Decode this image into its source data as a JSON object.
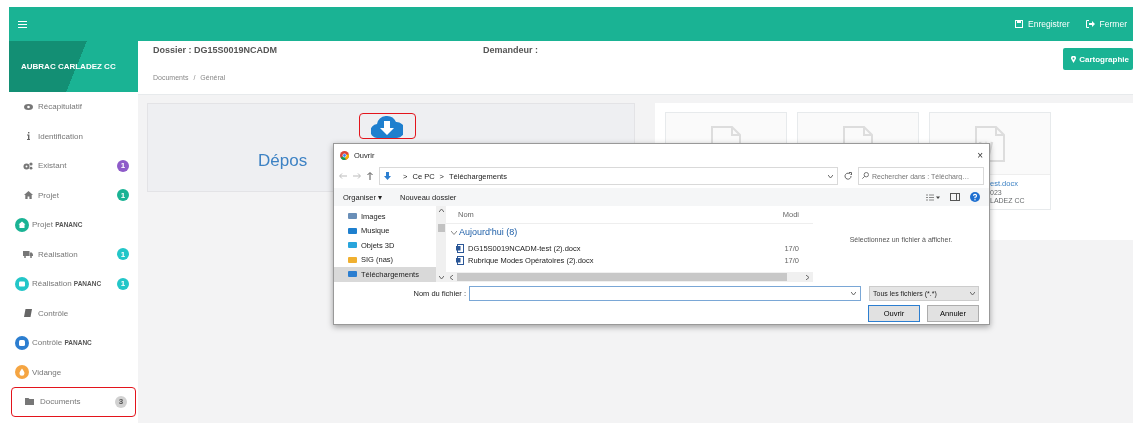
{
  "topbar": {
    "actions": [
      {
        "kind": "save",
        "label": "Enregistrer"
      },
      {
        "kind": "exit",
        "label": "Fermer"
      }
    ]
  },
  "sidebar": {
    "title": "AUBRAC CARLADEZ CC",
    "items": [
      {
        "kind": "plain",
        "label": "Récapitulatif",
        "highlighted": false
      },
      {
        "kind": "plain",
        "label": "Identification",
        "highlighted": false
      },
      {
        "kind": "plain",
        "label": "Existant",
        "badge": {
          "label": "1",
          "color": "#8e5bc9"
        },
        "highlighted": false
      },
      {
        "kind": "plain",
        "label": "Projet",
        "badge": {
          "label": "1",
          "color": "#1ab394"
        },
        "highlighted": false
      },
      {
        "kind": "round",
        "label": "Projet **PANANC**",
        "color": "#1ab394",
        "highlighted": false
      },
      {
        "kind": "plain",
        "label": "Réalisation",
        "badge": {
          "label": "1",
          "color": "#23c6c8"
        },
        "highlighted": false
      },
      {
        "kind": "round",
        "label": "Réalisation **PANANC**",
        "color": "#23c6c8",
        "badge": {
          "label": "1",
          "color": "#23c6c8"
        },
        "highlighted": false
      },
      {
        "kind": "plain",
        "label": "Contrôle",
        "highlighted": false
      },
      {
        "kind": "round",
        "label": "Contrôle **PANANC**",
        "color": "#2c7ed0",
        "highlighted": false
      },
      {
        "kind": "round",
        "label": "Vidange",
        "color": "#f5a542",
        "highlighted": false
      },
      {
        "kind": "plain",
        "label": "Documents",
        "badge": {
          "label": "3",
          "color": "#d1d1d1"
        },
        "highlighted": true
      }
    ]
  },
  "header": {
    "dossier": "Dossier : DG15S0019NCADM",
    "demandeur": "Demandeur :",
    "breadcrumb": {
      "items": [
        "Documents",
        "Général"
      ],
      "separator": "/"
    },
    "button": "Cartographie"
  },
  "upload": {
    "text": "Dépos",
    "highlighted": true
  },
  "files": [
    {
      "kind": "txt"
    },
    {
      "kind": "txt"
    },
    {
      "kind": "word",
      "name": "est.docx",
      "date": "023",
      "owner": "LADEZ CC"
    }
  ],
  "dialog": {
    "title": "Ouvrir",
    "close": "×",
    "path": [
      "Ce PC",
      "Téléchargements"
    ],
    "path_separator": ">",
    "search": {
      "placeholder": "Rechercher dans : Télécharg…"
    },
    "toolbar": [
      "Organiser ▾",
      "Nouveau dossier"
    ],
    "nav": [
      {
        "label": "Images",
        "selected": false
      },
      {
        "label": "Musique",
        "selected": false
      },
      {
        "label": "Objets 3D",
        "selected": false
      },
      {
        "label": "SIG (nas)",
        "selected": false
      },
      {
        "label": "Téléchargements",
        "selected": true
      }
    ],
    "columns": [
      "Nom",
      "Modi"
    ],
    "group": "Aujourd'hui (8)",
    "files": [
      {
        "name": "DG15S0019NCADM-test (2).docx",
        "date": "17/0"
      },
      {
        "name": "Rubrique Modes Opératoires (2).docx",
        "date": "17/0"
      }
    ],
    "preview": "Sélectionnez un fichier à afficher.",
    "filename_label": "Nom du fichier :",
    "filter": "Tous les fichiers (*.*)",
    "buttons": [
      "Ouvrir",
      "Annuler"
    ]
  }
}
